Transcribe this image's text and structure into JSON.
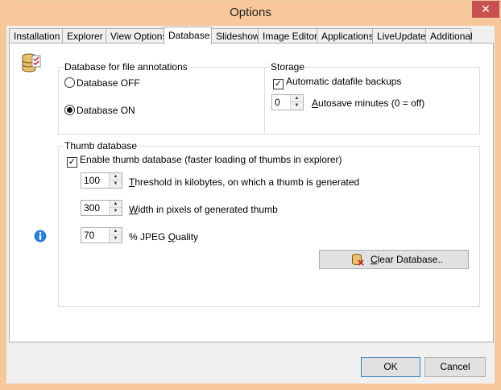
{
  "window": {
    "title": "Options",
    "close": "✕"
  },
  "tabs": [
    {
      "label": "Installation"
    },
    {
      "label": "Explorer"
    },
    {
      "label": "View Options"
    },
    {
      "label": "Database"
    },
    {
      "label": "Slideshow"
    },
    {
      "label": "Image Editor"
    },
    {
      "label": "Applications"
    },
    {
      "label": "LiveUpdate"
    },
    {
      "label": "Additional"
    }
  ],
  "active_tab": "Database",
  "db_group": {
    "title": "Database for file annotations",
    "off_label": "Database OFF",
    "on_label": "Database ON",
    "selected": "on"
  },
  "storage_group": {
    "title": "Storage",
    "auto_backup_label": "Automatic datafile backups",
    "auto_backup_checked": true,
    "autosave_value": "0",
    "autosave_label_first": "A",
    "autosave_label_rest": "utosave minutes (0 = off)"
  },
  "thumb_group": {
    "title": "Thumb database",
    "enable_label": "Enable thumb database (faster loading of thumbs in explorer)",
    "enable_checked": true,
    "threshold_value": "100",
    "threshold_label_first": "T",
    "threshold_label_rest": "hreshold in kilobytes, on which a thumb is generated",
    "width_value": "300",
    "width_label_first": "W",
    "width_label_rest": "idth in pixels of generated thumb",
    "quality_value": "70",
    "quality_label_pre": "% JPEG ",
    "quality_label_first": "Q",
    "quality_label_rest": "uality",
    "clear_label_first": "C",
    "clear_label_rest": "lear Database.."
  },
  "footer": {
    "ok_label": "OK",
    "cancel_label": "Cancel"
  },
  "colors": {
    "accent": "#3c7fb1",
    "titlebar": "#f6c89c",
    "close": "#c75050",
    "info": "#2a7fd4"
  }
}
